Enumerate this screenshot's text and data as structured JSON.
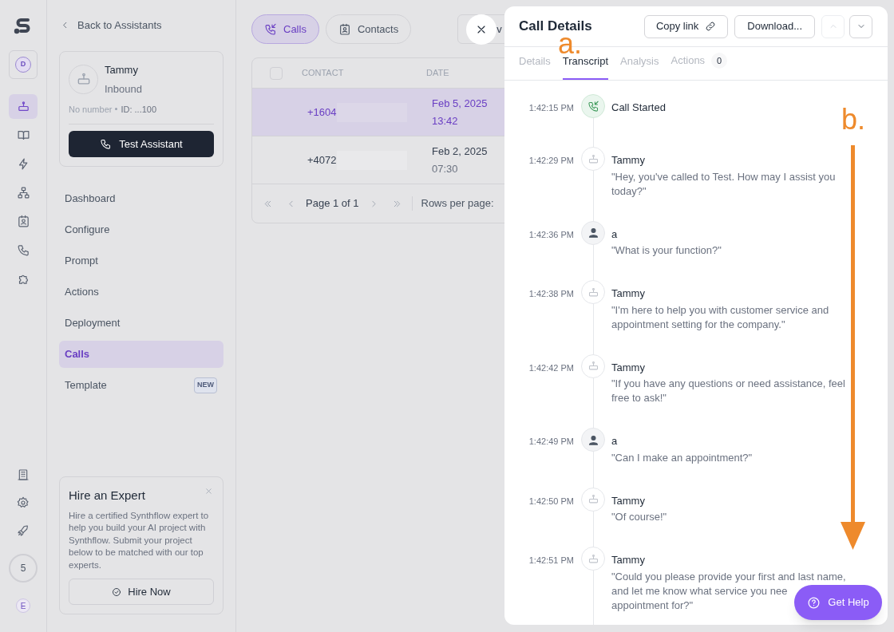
{
  "rail": {
    "avatar": "D",
    "items": [
      {
        "selected": true
      },
      {
        "selected": false
      },
      {
        "selected": false
      },
      {
        "selected": false
      },
      {
        "selected": false
      },
      {
        "selected": false
      },
      {
        "selected": false
      }
    ],
    "counter": "5",
    "user_initial": "E"
  },
  "sidebar": {
    "back": "Back to Assistants",
    "assistant": {
      "name": "Tammy",
      "direction": "Inbound",
      "number": "No number",
      "id": "ID: ...100",
      "test_button": "Test Assistant"
    },
    "nav": [
      {
        "label": "Dashboard",
        "selected": false
      },
      {
        "label": "Configure",
        "selected": false
      },
      {
        "label": "Prompt",
        "selected": false
      },
      {
        "label": "Actions",
        "selected": false
      },
      {
        "label": "Deployment",
        "selected": false
      },
      {
        "label": "Calls",
        "selected": true
      },
      {
        "label": "Template",
        "selected": false,
        "badge": "NEW"
      }
    ],
    "promo": {
      "title": "Hire an Expert",
      "body": "Hire a certified Synthflow expert to help you build your AI project with Synthflow. Submit your project below to be matched with our top experts.",
      "button": "Hire Now"
    }
  },
  "main": {
    "tabs": [
      {
        "label": "Calls",
        "selected": true
      },
      {
        "label": "Contacts",
        "selected": false
      }
    ],
    "partial_button": "v",
    "table": {
      "select_all_checked": false,
      "columns": [
        "CONTACT",
        "DATE"
      ],
      "rows": [
        {
          "contact": "+1604",
          "date": "Feb 5, 2025",
          "time": "13:42",
          "selected": true
        },
        {
          "contact": "+4072",
          "date": "Feb 2, 2025",
          "time": "07:30",
          "selected": false
        }
      ]
    },
    "pagination": {
      "page": "Page 1 of 1",
      "rows_per_page": "Rows per page:"
    }
  },
  "drawer": {
    "title": "Call Details",
    "copy_link": "Copy link",
    "download": "Download...",
    "tabs": [
      {
        "label": "Details",
        "selected": false
      },
      {
        "label": "Transcript",
        "selected": true
      },
      {
        "label": "Analysis",
        "selected": false
      },
      {
        "label": "Actions",
        "selected": false,
        "count": "0"
      }
    ],
    "transcript": [
      {
        "kind": "event",
        "time": "1:42:15 PM",
        "speaker": "Call Started"
      },
      {
        "kind": "agent",
        "time": "1:42:29 PM",
        "speaker": "Tammy",
        "text": "\"Hey, you've called to Test. How may I assist you today?\""
      },
      {
        "kind": "user",
        "time": "1:42:36 PM",
        "speaker": "a",
        "text": "\"What is your function?\""
      },
      {
        "kind": "agent",
        "time": "1:42:38 PM",
        "speaker": "Tammy",
        "text": "\"I'm here to help you with customer service and appointment setting for the company.\""
      },
      {
        "kind": "agent",
        "time": "1:42:42 PM",
        "speaker": "Tammy",
        "text": "\"If you have any questions or need assistance, feel free to ask!\""
      },
      {
        "kind": "user",
        "time": "1:42:49 PM",
        "speaker": "a",
        "text": "\"Can I make an appointment?\""
      },
      {
        "kind": "agent",
        "time": "1:42:50 PM",
        "speaker": "Tammy",
        "text": "\"Of course!\""
      },
      {
        "kind": "agent",
        "time": "1:42:51 PM",
        "speaker": "Tammy",
        "text": "\"Could you please provide your first and last name, and let me know what service you nee",
        "continuation": "appointment for?\""
      }
    ]
  },
  "help_button": "Get Help",
  "annotations": [
    {
      "label": "a."
    },
    {
      "label": "b."
    }
  ]
}
